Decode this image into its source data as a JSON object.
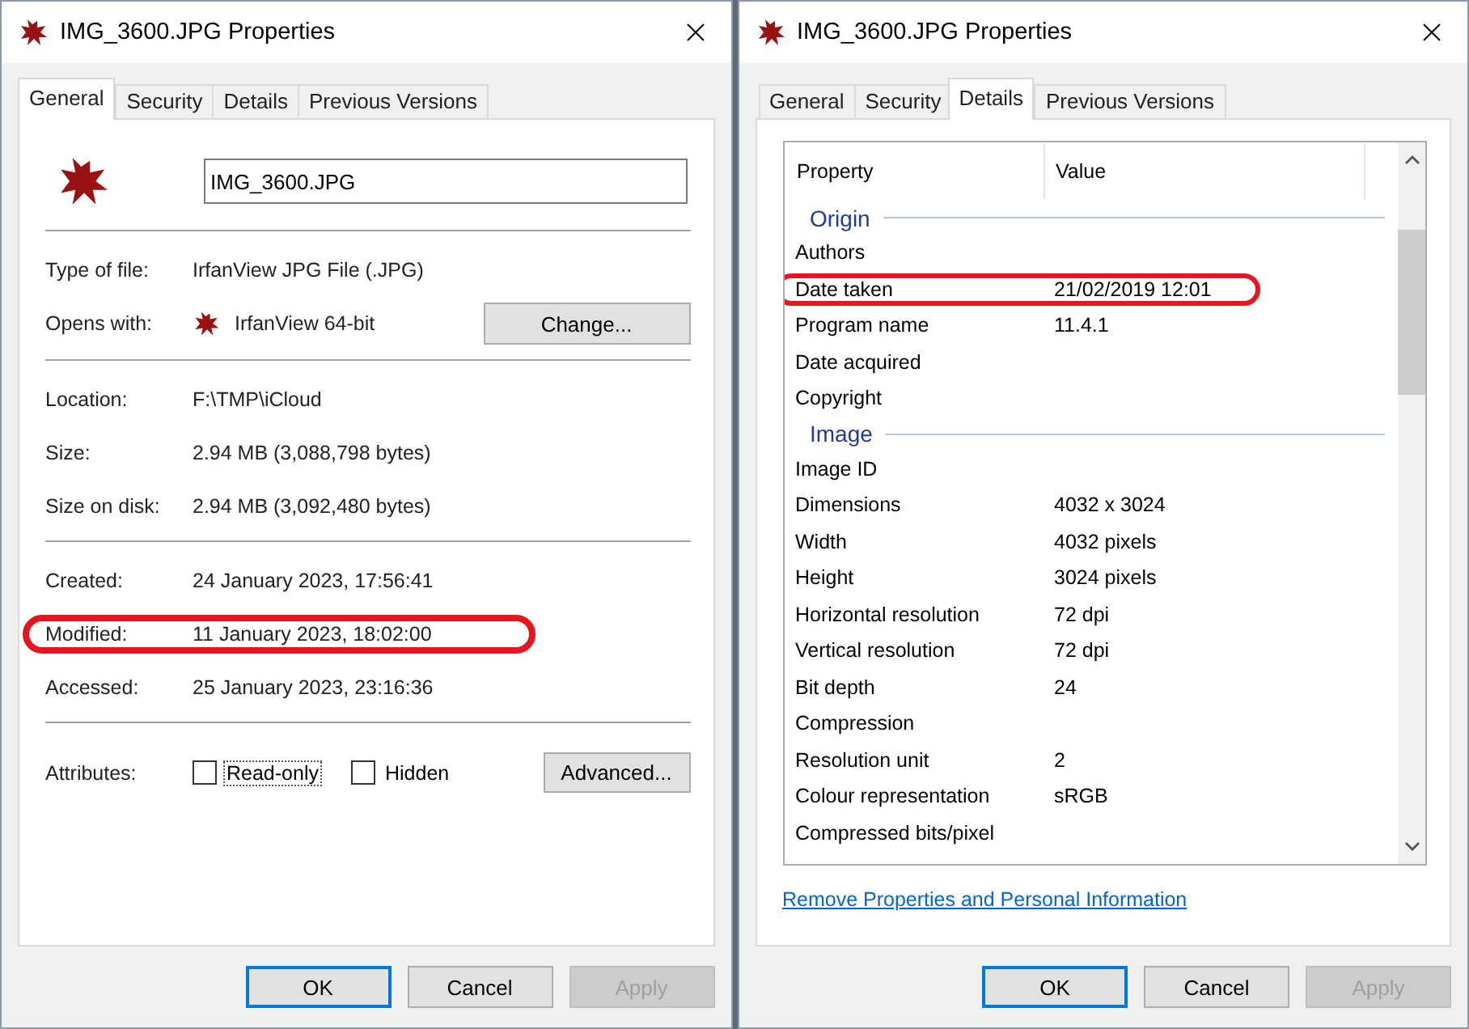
{
  "windows": [
    {
      "kind": "general",
      "title": "IMG_3600.JPG Properties",
      "tabs": [
        {
          "label": "General",
          "selected": true
        },
        {
          "label": "Security",
          "selected": false
        },
        {
          "label": "Details",
          "selected": false
        },
        {
          "label": "Previous Versions",
          "selected": false
        }
      ],
      "file_name": "IMG_3600.JPG",
      "sections": [
        [
          {
            "label": "Type of file:",
            "value": "IrfanView JPG File (.JPG)",
            "annotated": false
          },
          {
            "label": "Opens with:",
            "value": "IrfanView 64-bit",
            "app_icon": true,
            "button": "Change...",
            "annotated": false
          }
        ],
        [
          {
            "label": "Location:",
            "value": "F:\\TMP\\iCloud",
            "annotated": false
          },
          {
            "label": "Size:",
            "value": "2.94 MB (3,088,798 bytes)",
            "annotated": false
          },
          {
            "label": "Size on disk:",
            "value": "2.94 MB (3,092,480 bytes)",
            "annotated": false
          }
        ],
        [
          {
            "label": "Created:",
            "value": "24 January 2023, 17:56:41",
            "annotated": false
          },
          {
            "label": "Modified:",
            "value": "11 January 2023, 18:02:00",
            "annotated": true
          },
          {
            "label": "Accessed:",
            "value": "25 January 2023, 23:16:36",
            "annotated": false
          }
        ]
      ],
      "attributes": {
        "label": "Attributes:",
        "checkboxes": [
          {
            "label": "Read-only",
            "checked": false,
            "focused": true
          },
          {
            "label": "Hidden",
            "checked": false,
            "focused": false
          }
        ],
        "button": "Advanced..."
      },
      "buttons": [
        {
          "label": "OK",
          "default": true,
          "disabled": false
        },
        {
          "label": "Cancel",
          "default": false,
          "disabled": false
        },
        {
          "label": "Apply",
          "default": false,
          "disabled": true
        }
      ]
    },
    {
      "kind": "details",
      "title": "IMG_3600.JPG Properties",
      "tabs": [
        {
          "label": "General",
          "selected": false
        },
        {
          "label": "Security",
          "selected": false
        },
        {
          "label": "Details",
          "selected": true
        },
        {
          "label": "Previous Versions",
          "selected": false
        }
      ],
      "columns": [
        "Property",
        "Value"
      ],
      "groups": [
        {
          "name": "Origin",
          "rows": [
            {
              "property": "Authors",
              "value": "",
              "annotated": false
            },
            {
              "property": "Date taken",
              "value": "21/02/2019 12:01",
              "annotated": true
            },
            {
              "property": "Program name",
              "value": "11.4.1",
              "annotated": false
            },
            {
              "property": "Date acquired",
              "value": "",
              "annotated": false
            },
            {
              "property": "Copyright",
              "value": "",
              "annotated": false
            }
          ]
        },
        {
          "name": "Image",
          "rows": [
            {
              "property": "Image ID",
              "value": "",
              "annotated": false
            },
            {
              "property": "Dimensions",
              "value": "4032 x 3024",
              "annotated": false
            },
            {
              "property": "Width",
              "value": "4032 pixels",
              "annotated": false
            },
            {
              "property": "Height",
              "value": "3024 pixels",
              "annotated": false
            },
            {
              "property": "Horizontal resolution",
              "value": "72 dpi",
              "annotated": false
            },
            {
              "property": "Vertical resolution",
              "value": "72 dpi",
              "annotated": false
            },
            {
              "property": "Bit depth",
              "value": "24",
              "annotated": false
            },
            {
              "property": "Compression",
              "value": "",
              "annotated": false
            },
            {
              "property": "Resolution unit",
              "value": "2",
              "annotated": false
            },
            {
              "property": "Colour representation",
              "value": "sRGB",
              "annotated": false
            },
            {
              "property": "Compressed bits/pixel",
              "value": "",
              "annotated": false
            }
          ]
        }
      ],
      "link": "Remove Properties and Personal Information",
      "buttons": [
        {
          "label": "OK",
          "default": true,
          "disabled": false
        },
        {
          "label": "Cancel",
          "default": false,
          "disabled": false
        },
        {
          "label": "Apply",
          "default": false,
          "disabled": true
        }
      ]
    }
  ]
}
